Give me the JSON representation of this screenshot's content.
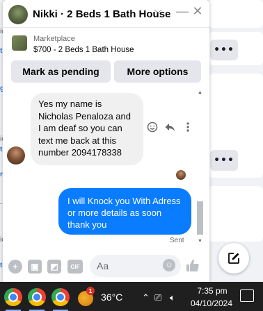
{
  "chat": {
    "title": "Nikki · 2 Beds 1 Bath House",
    "listing": {
      "label": "Marketplace",
      "price_title": "$700 - 2 Beds 1 Bath House"
    },
    "buttons": {
      "pending": "Mark as pending",
      "more": "More options"
    },
    "messages": [
      {
        "direction": "incoming",
        "text": "Yes my name is Nicholas Penaloza and I am deaf so you can text me back at this number 2094178338"
      },
      {
        "direction": "outgoing",
        "text": "I will Knock you With Adress or more details  as soon thank you"
      }
    ],
    "sent_status": "Sent",
    "composer": {
      "placeholder": "Aa"
    }
  },
  "taskbar": {
    "weather_badge": "1",
    "temperature": "36°C",
    "time": "7:35 pm",
    "date": "04/10/2024"
  },
  "icons": {
    "minimize": "minimize-icon",
    "close": "close-icon",
    "chevron": "chevron-down-icon",
    "new_message": "compose-icon"
  },
  "colors": {
    "accent": "#0a7cff",
    "incoming_bubble": "#f0f0f0",
    "taskbar": "#1f1f1f"
  }
}
